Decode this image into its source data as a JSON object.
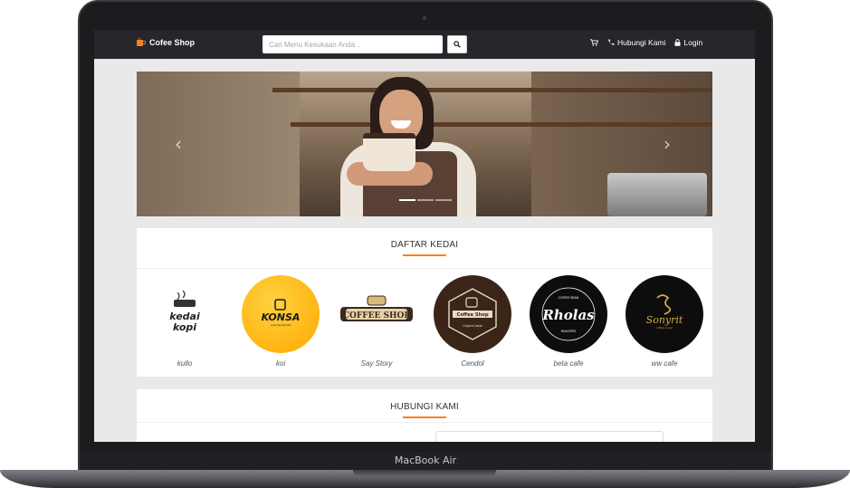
{
  "device": {
    "label": "MacBook Air"
  },
  "navbar": {
    "brand": "Cofee Shop",
    "search_placeholder": "Cari Menu Kesukaan Anda ..",
    "contact_label": "Hubungi Kami",
    "login_label": "Login"
  },
  "carousel": {
    "slide_count": 3,
    "active_index": 0
  },
  "shop_list": {
    "title": "DAFTAR KEDAI",
    "shops": [
      {
        "name": "kullo",
        "logo_text": "kedai kopi",
        "bg": "#ffffff",
        "fg": "#222222"
      },
      {
        "name": "koi",
        "logo_text": "KONSA",
        "bg": "#ffb400",
        "fg": "#1a1a1a"
      },
      {
        "name": "Say Story",
        "logo_text": "COFFEE SHOP",
        "bg": "#ffffff",
        "fg": "#3b2a1e"
      },
      {
        "name": "Cendol",
        "logo_text": "Coffee Shop",
        "bg": "#3b2518",
        "fg": "#ffffff"
      },
      {
        "name": "beta cafe",
        "logo_text": "Rholas",
        "bg": "#0d0d0d",
        "fg": "#ffffff"
      },
      {
        "name": "ww cafe",
        "logo_text": "Sonyrit",
        "bg": "#0d0d0d",
        "fg": "#d4a84a"
      }
    ]
  },
  "contact_section": {
    "title": "HUBUNGI KAMI"
  },
  "colors": {
    "accent": "#f58220",
    "navbar": "#25272c"
  }
}
